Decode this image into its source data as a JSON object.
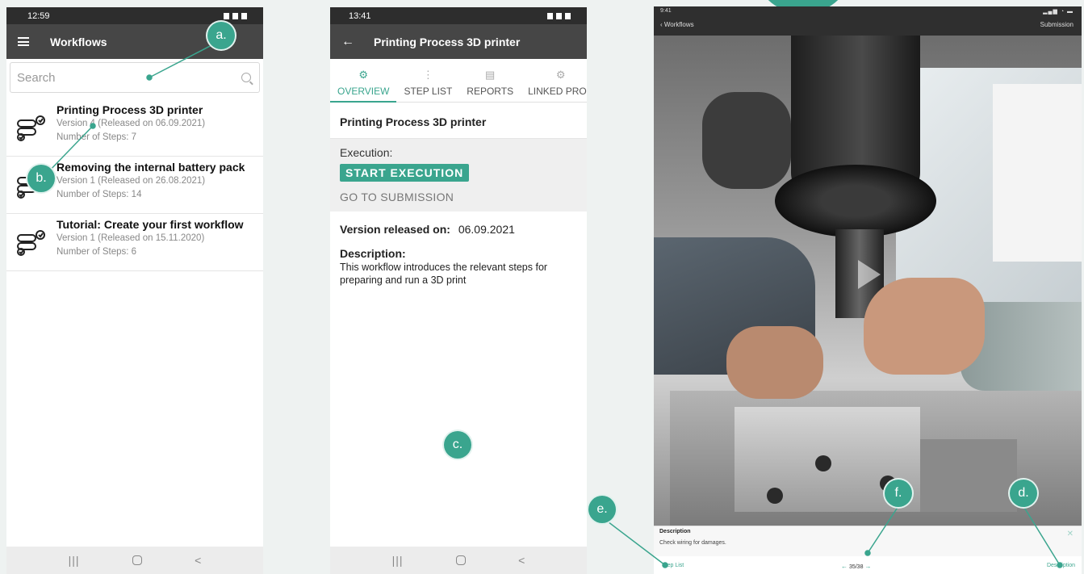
{
  "phone1": {
    "time": "12:59",
    "title": "Workflows",
    "search_placeholder": "Search",
    "workflows": [
      {
        "title": "Printing Process 3D printer",
        "version": "Version 4 (Released on 06.09.2021)",
        "steps": "Number of Steps: 7"
      },
      {
        "title": "Removing the internal battery pack",
        "version": "Version 1 (Released on 26.08.2021)",
        "steps": "Number of Steps: 14"
      },
      {
        "title": "Tutorial: Create your first workflow",
        "version": "Version 1 (Released on 15.11.2020)",
        "steps": "Number of Steps: 6"
      }
    ],
    "nav": {
      "recent": "|||",
      "back": "<"
    }
  },
  "phone2": {
    "time": "13:41",
    "title": "Printing Process 3D printer",
    "tabs": [
      {
        "label": "OVERVIEW",
        "active": true
      },
      {
        "label": "STEP LIST",
        "active": false
      },
      {
        "label": "REPORTS",
        "active": false
      },
      {
        "label": "LINKED PROD",
        "active": false
      }
    ],
    "heading": "Printing Process 3D printer",
    "execution_label": "Execution:",
    "start_button": "START EXECUTION",
    "goto_link": "GO TO SUBMISSION",
    "release_label": "Version released on:",
    "release_date": "06.09.2021",
    "description_label": "Description:",
    "description_text": "This workflow introduces the relevant steps for preparing and run a 3D print",
    "nav": {
      "recent": "|||",
      "back": "<"
    }
  },
  "tablet": {
    "time": "9:41",
    "back_label": "Workflows",
    "submission_label": "Submission",
    "description_label": "Description",
    "description_text": "Check wiring for damages.",
    "step_list": "Step List",
    "pager": "35/38",
    "description_button": "Description"
  },
  "markers": {
    "a": "a.",
    "b": "b.",
    "c": "c.",
    "d": "d.",
    "e": "e.",
    "f": "f."
  },
  "colors": {
    "accent": "#3aa58e",
    "appbar": "#464646",
    "statusbar": "#2d2d2d"
  }
}
